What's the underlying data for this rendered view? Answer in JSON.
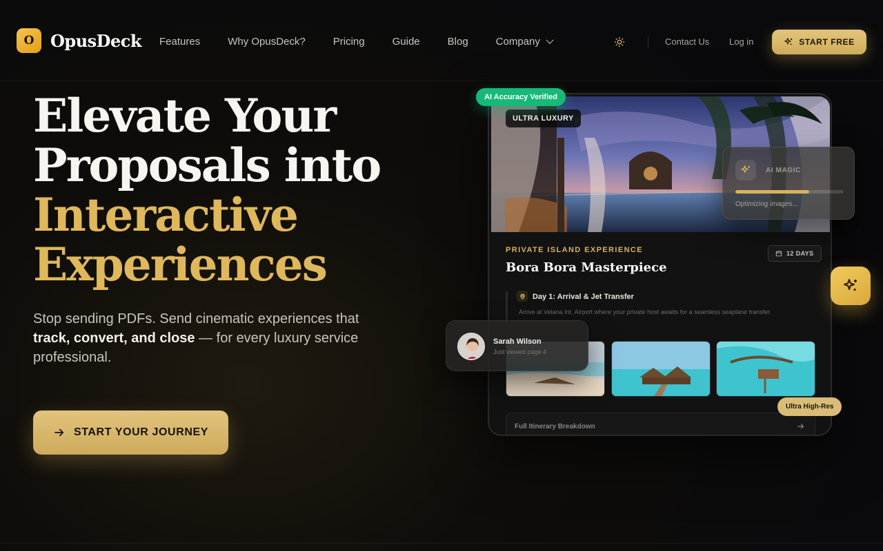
{
  "brand": {
    "mark": "O",
    "name": "OpusDeck"
  },
  "nav": {
    "items": [
      {
        "label": "Features"
      },
      {
        "label": "Why OpusDeck?"
      },
      {
        "label": "Pricing"
      },
      {
        "label": "Guide"
      },
      {
        "label": "Blog"
      },
      {
        "label": "Company"
      }
    ]
  },
  "header_actions": {
    "theme_icon": "sun-icon",
    "contact": "Contact Us",
    "login": "Log in",
    "start_free": "START FREE"
  },
  "hero": {
    "title_line1": "Elevate Your",
    "title_line2": "Proposals into",
    "title_line3": "Interactive",
    "title_line4": "Experiences",
    "sub_intro": "Stop sending PDFs. Send cinematic experiences that",
    "sub_bold": "track, convert, and close",
    "sub_outro": "— for every luxury service professional.",
    "cta": "START YOUR JOURNEY"
  },
  "mockup": {
    "accuracy_badge": "AI Accuracy Verified",
    "tier_badge": "ULTRA LUXURY",
    "eyebrow": "PRIVATE ISLAND EXPERIENCE",
    "title": "Bora Bora Masterpiece",
    "duration": "12 DAYS",
    "day_title": "Day 1: Arrival & Jet Transfer",
    "day_desc": "Arrive at Velana Int. Airport where your private host awaits for a seamless seaplane transfer.",
    "itinerary_label": "Full Itinerary Breakdown",
    "hires_badge": "Ultra High-Res"
  },
  "ai_card": {
    "label": "AI MAGIC",
    "status": "Optimizing images...",
    "progress": 0.68
  },
  "viewer": {
    "name": "Sarah Wilson",
    "status": "Just viewed page 4"
  },
  "colors": {
    "accent_gold": "#dfb85c",
    "accent_green": "#17b978",
    "background": "#0e0d0b"
  }
}
